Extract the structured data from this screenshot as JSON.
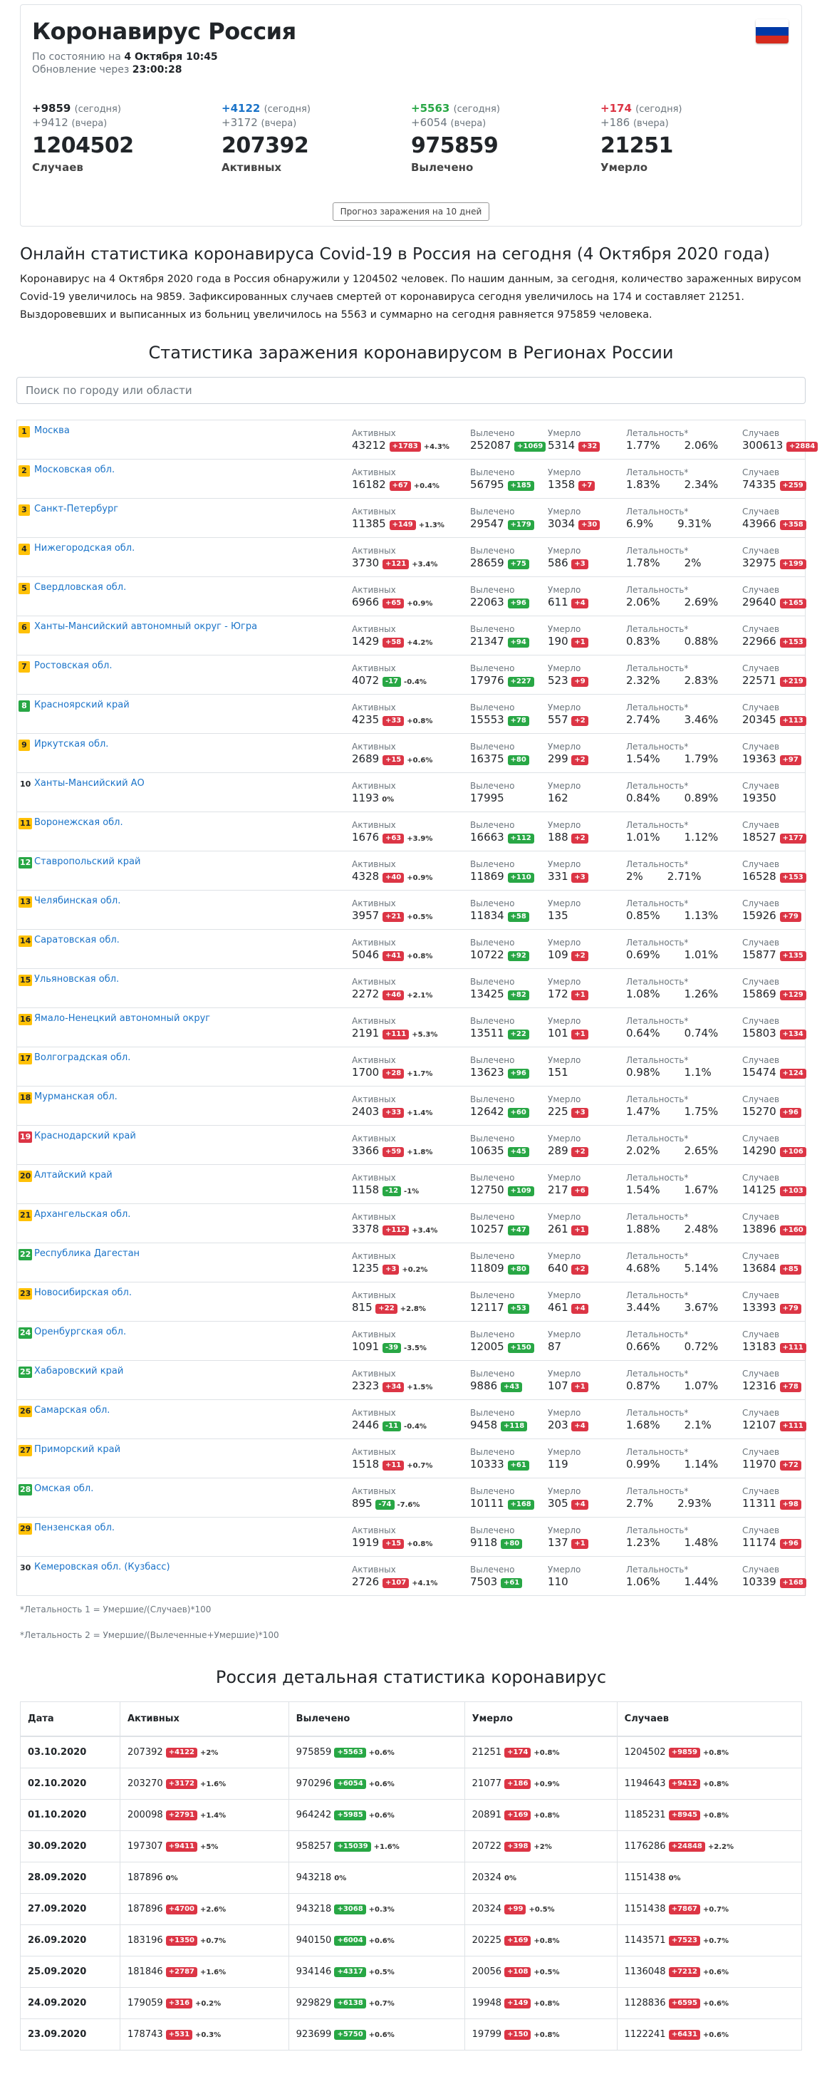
{
  "header": {
    "title": "Коронавирус Россия",
    "as_of_prefix": "По состоянию на",
    "as_of_value": "4 Октября 10:45",
    "update_prefix": "Обновление через",
    "update_value": "23:00:28",
    "flag_colors": [
      "#ffffff",
      "#0039a6",
      "#d52b1e"
    ]
  },
  "labels": {
    "today": "(сегодня)",
    "yesterday": "(вчера)"
  },
  "stats": [
    {
      "today": "+9859",
      "yesterday": "+9412",
      "total": "1204502",
      "name": "Случаев",
      "color": "#212529"
    },
    {
      "today": "+4122",
      "yesterday": "+3172",
      "total": "207392",
      "name": "Активных",
      "color": "#1a73c8"
    },
    {
      "today": "+5563",
      "yesterday": "+6054",
      "total": "975859",
      "name": "Вылечено",
      "color": "#28a745"
    },
    {
      "today": "+174",
      "yesterday": "+186",
      "total": "21251",
      "name": "Умерло",
      "color": "#dc3545"
    }
  ],
  "forecast_button": "Прогноз заражения на 10 дней",
  "online_title": "Онлайн статистика коронавируса Covid-19 в Россия на сегодня (4 Октября 2020 года)",
  "description": "Коронавирус на 4 Октября 2020 года в Россия обнаружили у 1204502 человек. По нашим данным, за сегодня, количество зараженных вирусом Covid-19 увеличилось на 9859. Зафиксированных случаев смертей от коронавируса сегодня увеличилось на 174 и составляет 21251. Выздоровевших и выписанных из больниц увеличилось на 5563 и суммарно на сегодня равняется 975859 человека.",
  "regions_title": "Статистика заражения коронавирусом в Регионах России",
  "search_placeholder": "Поиск по городу или области",
  "col_labels": {
    "active": "Активных",
    "recovered": "Вылечено",
    "died": "Умерло",
    "lethality": "Летальность*",
    "cases": "Случаев"
  },
  "regions": [
    {
      "n": "1",
      "name": "Москва",
      "act": "43212",
      "act_d": "+1783",
      "act_p": "+4.3%",
      "rec": "252087",
      "rec_d": "+1069",
      "die": "5314",
      "die_d": "+32",
      "l1": "1.77%",
      "l2": "2.06%",
      "cases": "300613",
      "cases_d": "+2884"
    },
    {
      "n": "2",
      "name": "Московская обл.",
      "act": "16182",
      "act_d": "+67",
      "act_p": "+0.4%",
      "rec": "56795",
      "rec_d": "+185",
      "die": "1358",
      "die_d": "+7",
      "l1": "1.83%",
      "l2": "2.34%",
      "cases": "74335",
      "cases_d": "+259"
    },
    {
      "n": "3",
      "name": "Санкт-Петербург",
      "act": "11385",
      "act_d": "+149",
      "act_p": "+1.3%",
      "rec": "29547",
      "rec_d": "+179",
      "die": "3034",
      "die_d": "+30",
      "l1": "6.9%",
      "l2": "9.31%",
      "cases": "43966",
      "cases_d": "+358"
    },
    {
      "n": "4",
      "name": "Нижегородская обл.",
      "act": "3730",
      "act_d": "+121",
      "act_p": "+3.4%",
      "rec": "28659",
      "rec_d": "+75",
      "die": "586",
      "die_d": "+3",
      "l1": "1.78%",
      "l2": "2%",
      "cases": "32975",
      "cases_d": "+199"
    },
    {
      "n": "5",
      "name": "Свердловская обл.",
      "act": "6966",
      "act_d": "+65",
      "act_p": "+0.9%",
      "rec": "22063",
      "rec_d": "+96",
      "die": "611",
      "die_d": "+4",
      "l1": "2.06%",
      "l2": "2.69%",
      "cases": "29640",
      "cases_d": "+165"
    },
    {
      "n": "6",
      "name": "Ханты-Мансийский автономный округ - Югра",
      "act": "1429",
      "act_d": "+58",
      "act_p": "+4.2%",
      "rec": "21347",
      "rec_d": "+94",
      "die": "190",
      "die_d": "+1",
      "l1": "0.83%",
      "l2": "0.88%",
      "cases": "22966",
      "cases_d": "+153"
    },
    {
      "n": "7",
      "name": "Ростовская обл.",
      "act": "4072",
      "act_d": "-17",
      "act_p": "-0.4%",
      "rec": "17976",
      "rec_d": "+227",
      "die": "523",
      "die_d": "+9",
      "l1": "2.32%",
      "l2": "2.83%",
      "cases": "22571",
      "cases_d": "+219"
    },
    {
      "n": "8",
      "name": "Красноярский край",
      "act": "4235",
      "act_d": "+33",
      "act_p": "+0.8%",
      "rec": "15553",
      "rec_d": "+78",
      "die": "557",
      "die_d": "+2",
      "l1": "2.74%",
      "l2": "3.46%",
      "cases": "20345",
      "cases_d": "+113"
    },
    {
      "n": "9",
      "name": "Иркутская обл.",
      "act": "2689",
      "act_d": "+15",
      "act_p": "+0.6%",
      "rec": "16375",
      "rec_d": "+80",
      "die": "299",
      "die_d": "+2",
      "l1": "1.54%",
      "l2": "1.79%",
      "cases": "19363",
      "cases_d": "+97"
    },
    {
      "n": "10",
      "name": "Ханты-Мансийский АО",
      "act": "1193",
      "act_d": "",
      "act_p": "0%",
      "rec": "17995",
      "rec_d": "",
      "die": "162",
      "die_d": "",
      "l1": "0.84%",
      "l2": "0.89%",
      "cases": "19350",
      "cases_d": ""
    },
    {
      "n": "11",
      "name": "Воронежская обл.",
      "act": "1676",
      "act_d": "+63",
      "act_p": "+3.9%",
      "rec": "16663",
      "rec_d": "+112",
      "die": "188",
      "die_d": "+2",
      "l1": "1.01%",
      "l2": "1.12%",
      "cases": "18527",
      "cases_d": "+177"
    },
    {
      "n": "12",
      "name": "Ставропольский край",
      "act": "4328",
      "act_d": "+40",
      "act_p": "+0.9%",
      "rec": "11869",
      "rec_d": "+110",
      "die": "331",
      "die_d": "+3",
      "l1": "2%",
      "l2": "2.71%",
      "cases": "16528",
      "cases_d": "+153"
    },
    {
      "n": "13",
      "name": "Челябинская обл.",
      "act": "3957",
      "act_d": "+21",
      "act_p": "+0.5%",
      "rec": "11834",
      "rec_d": "+58",
      "die": "135",
      "die_d": "",
      "l1": "0.85%",
      "l2": "1.13%",
      "cases": "15926",
      "cases_d": "+79"
    },
    {
      "n": "14",
      "name": "Саратовская обл.",
      "act": "5046",
      "act_d": "+41",
      "act_p": "+0.8%",
      "rec": "10722",
      "rec_d": "+92",
      "die": "109",
      "die_d": "+2",
      "l1": "0.69%",
      "l2": "1.01%",
      "cases": "15877",
      "cases_d": "+135"
    },
    {
      "n": "15",
      "name": "Ульяновская обл.",
      "act": "2272",
      "act_d": "+46",
      "act_p": "+2.1%",
      "rec": "13425",
      "rec_d": "+82",
      "die": "172",
      "die_d": "+1",
      "l1": "1.08%",
      "l2": "1.26%",
      "cases": "15869",
      "cases_d": "+129"
    },
    {
      "n": "16",
      "name": "Ямало-Ненецкий автономный округ",
      "act": "2191",
      "act_d": "+111",
      "act_p": "+5.3%",
      "rec": "13511",
      "rec_d": "+22",
      "die": "101",
      "die_d": "+1",
      "l1": "0.64%",
      "l2": "0.74%",
      "cases": "15803",
      "cases_d": "+134"
    },
    {
      "n": "17",
      "name": "Волгоградская обл.",
      "act": "1700",
      "act_d": "+28",
      "act_p": "+1.7%",
      "rec": "13623",
      "rec_d": "+96",
      "die": "151",
      "die_d": "",
      "l1": "0.98%",
      "l2": "1.1%",
      "cases": "15474",
      "cases_d": "+124"
    },
    {
      "n": "18",
      "name": "Мурманская обл.",
      "act": "2403",
      "act_d": "+33",
      "act_p": "+1.4%",
      "rec": "12642",
      "rec_d": "+60",
      "die": "225",
      "die_d": "+3",
      "l1": "1.47%",
      "l2": "1.75%",
      "cases": "15270",
      "cases_d": "+96"
    },
    {
      "n": "19",
      "name": "Краснодарский край",
      "act": "3366",
      "act_d": "+59",
      "act_p": "+1.8%",
      "rec": "10635",
      "rec_d": "+45",
      "die": "289",
      "die_d": "+2",
      "l1": "2.02%",
      "l2": "2.65%",
      "cases": "14290",
      "cases_d": "+106"
    },
    {
      "n": "20",
      "name": "Алтайский край",
      "act": "1158",
      "act_d": "-12",
      "act_p": "-1%",
      "rec": "12750",
      "rec_d": "+109",
      "die": "217",
      "die_d": "+6",
      "l1": "1.54%",
      "l2": "1.67%",
      "cases": "14125",
      "cases_d": "+103"
    },
    {
      "n": "21",
      "name": "Архангельская обл.",
      "act": "3378",
      "act_d": "+112",
      "act_p": "+3.4%",
      "rec": "10257",
      "rec_d": "+47",
      "die": "261",
      "die_d": "+1",
      "l1": "1.88%",
      "l2": "2.48%",
      "cases": "13896",
      "cases_d": "+160"
    },
    {
      "n": "22",
      "name": "Республика Дагестан",
      "act": "1235",
      "act_d": "+3",
      "act_p": "+0.2%",
      "rec": "11809",
      "rec_d": "+80",
      "die": "640",
      "die_d": "+2",
      "l1": "4.68%",
      "l2": "5.14%",
      "cases": "13684",
      "cases_d": "+85"
    },
    {
      "n": "23",
      "name": "Новосибирская обл.",
      "act": "815",
      "act_d": "+22",
      "act_p": "+2.8%",
      "rec": "12117",
      "rec_d": "+53",
      "die": "461",
      "die_d": "+4",
      "l1": "3.44%",
      "l2": "3.67%",
      "cases": "13393",
      "cases_d": "+79"
    },
    {
      "n": "24",
      "name": "Оренбургская обл.",
      "act": "1091",
      "act_d": "-39",
      "act_p": "-3.5%",
      "rec": "12005",
      "rec_d": "+150",
      "die": "87",
      "die_d": "",
      "l1": "0.66%",
      "l2": "0.72%",
      "cases": "13183",
      "cases_d": "+111"
    },
    {
      "n": "25",
      "name": "Хабаровский край",
      "act": "2323",
      "act_d": "+34",
      "act_p": "+1.5%",
      "rec": "9886",
      "rec_d": "+43",
      "die": "107",
      "die_d": "+1",
      "l1": "0.87%",
      "l2": "1.07%",
      "cases": "12316",
      "cases_d": "+78"
    },
    {
      "n": "26",
      "name": "Самарская обл.",
      "act": "2446",
      "act_d": "-11",
      "act_p": "-0.4%",
      "rec": "9458",
      "rec_d": "+118",
      "die": "203",
      "die_d": "+4",
      "l1": "1.68%",
      "l2": "2.1%",
      "cases": "12107",
      "cases_d": "+111"
    },
    {
      "n": "27",
      "name": "Приморский край",
      "act": "1518",
      "act_d": "+11",
      "act_p": "+0.7%",
      "rec": "10333",
      "rec_d": "+61",
      "die": "119",
      "die_d": "",
      "l1": "0.99%",
      "l2": "1.14%",
      "cases": "11970",
      "cases_d": "+72"
    },
    {
      "n": "28",
      "name": "Омская обл.",
      "act": "895",
      "act_d": "-74",
      "act_p": "-7.6%",
      "rec": "10111",
      "rec_d": "+168",
      "die": "305",
      "die_d": "+4",
      "l1": "2.7%",
      "l2": "2.93%",
      "cases": "11311",
      "cases_d": "+98"
    },
    {
      "n": "29",
      "name": "Пензенская обл.",
      "act": "1919",
      "act_d": "+15",
      "act_p": "+0.8%",
      "rec": "9118",
      "rec_d": "+80",
      "die": "137",
      "die_d": "+1",
      "l1": "1.23%",
      "l2": "1.48%",
      "cases": "11174",
      "cases_d": "+96"
    },
    {
      "n": "30",
      "name": "Кемеровская обл. (Кузбасс)",
      "act": "2726",
      "act_d": "+107",
      "act_p": "+4.1%",
      "rec": "7503",
      "rec_d": "+61",
      "die": "110",
      "die_d": "",
      "l1": "1.06%",
      "l2": "1.44%",
      "cases": "10339",
      "cases_d": "+168"
    }
  ],
  "notes": {
    "n1": "*Летальность 1 = Умершие/(Случаев)*100",
    "n2": "*Летальность 2 = Умершие/(Вылеченные+Умершие)*100"
  },
  "detail_title": "Россия детальная статистика коронавирус",
  "detail_headers": [
    "Дата",
    "Активных",
    "Вылечено",
    "Умерло",
    "Случаев"
  ],
  "detail_rows": [
    {
      "date": "03.10.2020",
      "act": "207392",
      "act_d": "+4122",
      "act_p": "+2%",
      "rec": "975859",
      "rec_d": "+5563",
      "rec_p": "+0.6%",
      "die": "21251",
      "die_d": "+174",
      "die_p": "+0.8%",
      "cases": "1204502",
      "cases_d": "+9859",
      "cases_p": "+0.8%"
    },
    {
      "date": "02.10.2020",
      "act": "203270",
      "act_d": "+3172",
      "act_p": "+1.6%",
      "rec": "970296",
      "rec_d": "+6054",
      "rec_p": "+0.6%",
      "die": "21077",
      "die_d": "+186",
      "die_p": "+0.9%",
      "cases": "1194643",
      "cases_d": "+9412",
      "cases_p": "+0.8%"
    },
    {
      "date": "01.10.2020",
      "act": "200098",
      "act_d": "+2791",
      "act_p": "+1.4%",
      "rec": "964242",
      "rec_d": "+5985",
      "rec_p": "+0.6%",
      "die": "20891",
      "die_d": "+169",
      "die_p": "+0.8%",
      "cases": "1185231",
      "cases_d": "+8945",
      "cases_p": "+0.8%"
    },
    {
      "date": "30.09.2020",
      "act": "197307",
      "act_d": "+9411",
      "act_p": "+5%",
      "rec": "958257",
      "rec_d": "+15039",
      "rec_p": "+1.6%",
      "die": "20722",
      "die_d": "+398",
      "die_p": "+2%",
      "cases": "1176286",
      "cases_d": "+24848",
      "cases_p": "+2.2%"
    },
    {
      "date": "28.09.2020",
      "act": "187896",
      "act_d": "",
      "act_p": "0%",
      "rec": "943218",
      "rec_d": "",
      "rec_p": "0%",
      "die": "20324",
      "die_d": "",
      "die_p": "0%",
      "cases": "1151438",
      "cases_d": "",
      "cases_p": "0%"
    },
    {
      "date": "27.09.2020",
      "act": "187896",
      "act_d": "+4700",
      "act_p": "+2.6%",
      "rec": "943218",
      "rec_d": "+3068",
      "rec_p": "+0.3%",
      "die": "20324",
      "die_d": "+99",
      "die_p": "+0.5%",
      "cases": "1151438",
      "cases_d": "+7867",
      "cases_p": "+0.7%"
    },
    {
      "date": "26.09.2020",
      "act": "183196",
      "act_d": "+1350",
      "act_p": "+0.7%",
      "rec": "940150",
      "rec_d": "+6004",
      "rec_p": "+0.6%",
      "die": "20225",
      "die_d": "+169",
      "die_p": "+0.8%",
      "cases": "1143571",
      "cases_d": "+7523",
      "cases_p": "+0.7%"
    },
    {
      "date": "25.09.2020",
      "act": "181846",
      "act_d": "+2787",
      "act_p": "+1.6%",
      "rec": "934146",
      "rec_d": "+4317",
      "rec_p": "+0.5%",
      "die": "20056",
      "die_d": "+108",
      "die_p": "+0.5%",
      "cases": "1136048",
      "cases_d": "+7212",
      "cases_p": "+0.6%"
    },
    {
      "date": "24.09.2020",
      "act": "179059",
      "act_d": "+316",
      "act_p": "+0.2%",
      "rec": "929829",
      "rec_d": "+6138",
      "rec_p": "+0.7%",
      "die": "19948",
      "die_d": "+149",
      "die_p": "+0.8%",
      "cases": "1128836",
      "cases_d": "+6595",
      "cases_p": "+0.6%"
    },
    {
      "date": "23.09.2020",
      "act": "178743",
      "act_d": "+531",
      "act_p": "+0.3%",
      "rec": "923699",
      "rec_d": "+5750",
      "rec_p": "+0.6%",
      "die": "19799",
      "die_d": "+150",
      "die_p": "+0.8%",
      "cases": "1122241",
      "cases_d": "+6431",
      "cases_p": "+0.6%"
    }
  ],
  "colors": {
    "rank_top": "#ffc107",
    "rank_alt1": "#28a745",
    "rank_alt2": "#dc3545",
    "link": "#1a73c8",
    "badge_up": "#dc3545",
    "badge_good": "#28a745"
  }
}
